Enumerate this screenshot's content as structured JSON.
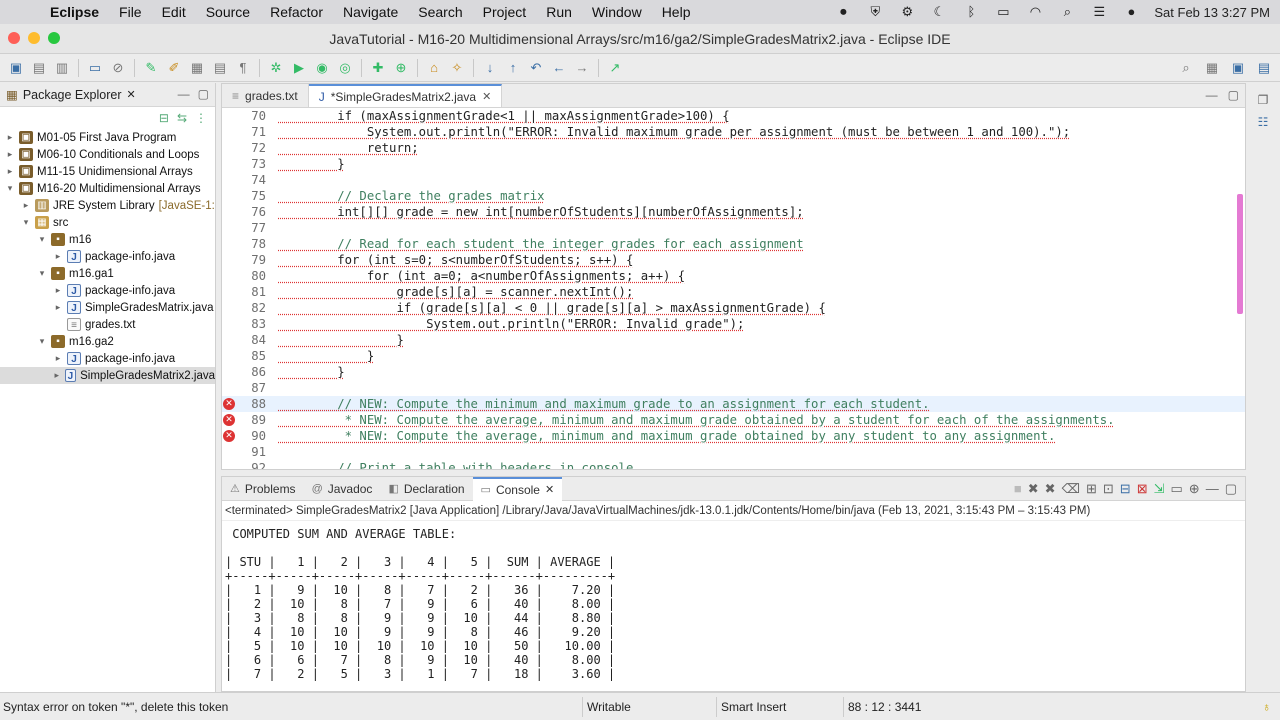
{
  "menubar": {
    "app": "Eclipse",
    "items": [
      "File",
      "Edit",
      "Source",
      "Refactor",
      "Navigate",
      "Search",
      "Project",
      "Run",
      "Window",
      "Help"
    ],
    "clock": "Sat Feb 13  3:27 PM"
  },
  "window": {
    "title": "JavaTutorial - M16-20 Multidimensional Arrays/src/m16/ga2/SimpleGradesMatrix2.java - Eclipse IDE"
  },
  "package_explorer": {
    "title": "Package Explorer",
    "tree": [
      {
        "label": "M01-05 First Java Program",
        "depth": 0,
        "icon": "project",
        "expanded": false
      },
      {
        "label": "M06-10 Conditionals and Loops",
        "depth": 0,
        "icon": "project",
        "expanded": false
      },
      {
        "label": "M11-15 Unidimensional Arrays",
        "depth": 0,
        "icon": "project",
        "expanded": false
      },
      {
        "label": "M16-20 Multidimensional Arrays",
        "depth": 0,
        "icon": "project",
        "expanded": true
      },
      {
        "label": "JRE System Library",
        "decoration": "[JavaSE-1:",
        "depth": 1,
        "icon": "library",
        "expanded": false
      },
      {
        "label": "src",
        "depth": 1,
        "icon": "src",
        "expanded": true
      },
      {
        "label": "m16",
        "depth": 2,
        "icon": "package",
        "expanded": true
      },
      {
        "label": "package-info.java",
        "depth": 3,
        "icon": "java",
        "expanded": false
      },
      {
        "label": "m16.ga1",
        "depth": 2,
        "icon": "package",
        "expanded": true
      },
      {
        "label": "package-info.java",
        "depth": 3,
        "icon": "java",
        "expanded": false
      },
      {
        "label": "SimpleGradesMatrix.java",
        "depth": 3,
        "icon": "java",
        "expanded": false
      },
      {
        "label": "grades.txt",
        "depth": 3,
        "icon": "text",
        "leaf": true
      },
      {
        "label": "m16.ga2",
        "depth": 2,
        "icon": "package",
        "expanded": true
      },
      {
        "label": "package-info.java",
        "depth": 3,
        "icon": "java",
        "expanded": false
      },
      {
        "label": "SimpleGradesMatrix2.java",
        "depth": 3,
        "icon": "java",
        "expanded": false,
        "selected": true
      }
    ]
  },
  "editor": {
    "tabs": [
      {
        "label": "grades.txt",
        "active": false
      },
      {
        "label": "*SimpleGradesMatrix2.java",
        "active": true
      }
    ],
    "lines": [
      {
        "n": "70",
        "text": "        if (maxAssignmentGrade<1 || maxAssignmentGrade>100) {"
      },
      {
        "n": "71",
        "text": "            System.out.println(\"ERROR: Invalid maximum grade per assignment (must be between 1 and 100).\");"
      },
      {
        "n": "72",
        "text": "            return;"
      },
      {
        "n": "73",
        "text": "        }"
      },
      {
        "n": "74",
        "text": ""
      },
      {
        "n": "75",
        "text": "        // Declare the grades matrix"
      },
      {
        "n": "76",
        "text": "        int[][] grade = new int[numberOfStudents][numberOfAssignments];"
      },
      {
        "n": "77",
        "text": ""
      },
      {
        "n": "78",
        "text": "        // Read for each student the integer grades for each assignment"
      },
      {
        "n": "79",
        "text": "        for (int s=0; s<numberOfStudents; s++) {"
      },
      {
        "n": "80",
        "text": "            for (int a=0; a<numberOfAssignments; a++) {"
      },
      {
        "n": "81",
        "text": "                grade[s][a] = scanner.nextInt();"
      },
      {
        "n": "82",
        "text": "                if (grade[s][a] < 0 || grade[s][a] > maxAssignmentGrade) {"
      },
      {
        "n": "83",
        "text": "                    System.out.println(\"ERROR: Invalid grade\");"
      },
      {
        "n": "84",
        "text": "                }"
      },
      {
        "n": "85",
        "text": "            }"
      },
      {
        "n": "86",
        "text": "        }"
      },
      {
        "n": "87",
        "text": ""
      },
      {
        "n": "88",
        "text": "        // NEW: Compute the minimum and maximum grade to an assignment for each student.",
        "error": true,
        "current": true
      },
      {
        "n": "89",
        "text": "         * NEW: Compute the average, minimum and maximum grade obtained by a student for each of the assignments.",
        "error": true
      },
      {
        "n": "90",
        "text": "         * NEW: Compute the average, minimum and maximum grade obtained by any student to any assignment.",
        "error": true
      },
      {
        "n": "91",
        "text": ""
      },
      {
        "n": "92",
        "text": "        // Print a table with headers in console"
      }
    ]
  },
  "console": {
    "tabs": [
      "Problems",
      "Javadoc",
      "Declaration",
      "Console"
    ],
    "active_tab": "Console",
    "terminated": "<terminated> SimpleGradesMatrix2 [Java Application] /Library/Java/JavaVirtualMachines/jdk-13.0.1.jdk/Contents/Home/bin/java  (Feb 13, 2021, 3:15:43 PM – 3:15:43 PM)",
    "output": " COMPUTED SUM AND AVERAGE TABLE:\n\n| STU |   1 |   2 |   3 |   4 |   5 |  SUM | AVERAGE |\n+-----+-----+-----+-----+-----+-----+------+---------+\n|   1 |   9 |  10 |   8 |   7 |   2 |   36 |    7.20 |\n|   2 |  10 |   8 |   7 |   9 |   6 |   40 |    8.00 |\n|   3 |   8 |   8 |   9 |   9 |  10 |   44 |    8.80 |\n|   4 |  10 |  10 |   9 |   9 |   8 |   46 |    9.20 |\n|   5 |  10 |  10 |  10 |  10 |  10 |   50 |   10.00 |\n|   6 |   6 |   7 |   8 |   9 |  10 |   40 |    8.00 |\n|   7 |   2 |   5 |   3 |   1 |   7 |   18 |    3.60 |"
  },
  "status": {
    "message": "Syntax error on token \"*\", delete this token",
    "mode": "Writable",
    "insert": "Smart Insert",
    "position": "88 : 12 : 3441"
  }
}
